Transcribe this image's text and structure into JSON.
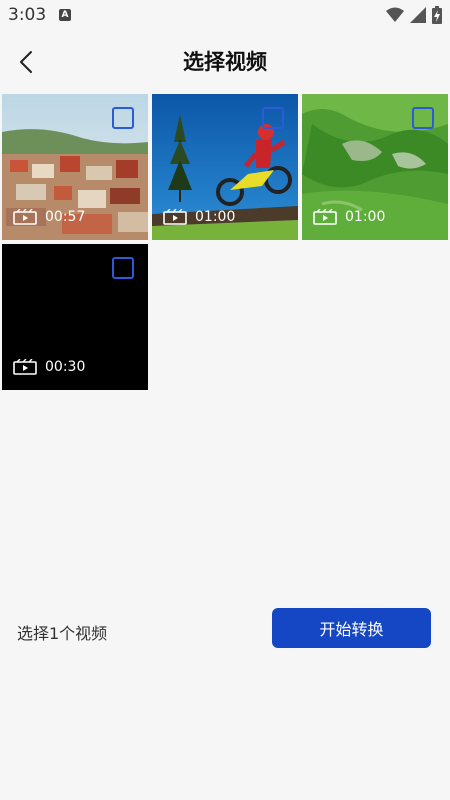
{
  "status_bar": {
    "time": "3:03",
    "notification_icon": "a-icon",
    "icons": [
      "wifi-icon",
      "signal-icon",
      "battery-icon"
    ]
  },
  "header": {
    "title": "选择视频",
    "back_icon": "chevron-left-icon"
  },
  "videos": [
    {
      "duration": "00:57",
      "thumbnail": "town-scene",
      "selected": false
    },
    {
      "duration": "01:00",
      "thumbnail": "motocross-scene",
      "selected": false
    },
    {
      "duration": "01:00",
      "thumbnail": "green-hills-scene",
      "selected": false
    },
    {
      "duration": "00:30",
      "thumbnail": "black-frame",
      "selected": false
    }
  ],
  "footer": {
    "selected_text": "选择1个视频",
    "start_button": "开始转换"
  },
  "colors": {
    "accent": "#1546c4",
    "checkbox_border": "#2b5bd6",
    "background": "#f6f6f6"
  }
}
